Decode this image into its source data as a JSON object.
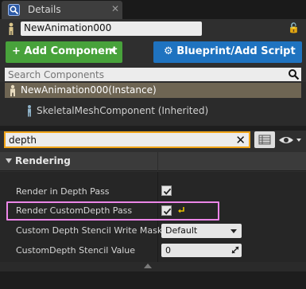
{
  "tab": {
    "title": "Details",
    "close_glyph": "✕",
    "icon": "details-magnifier-icon"
  },
  "actor": {
    "name": "NewAnimation000",
    "lock_glyph": "🔓"
  },
  "toolbar": {
    "add_component_label": "+ Add Component",
    "blueprint_label": "Blueprint/Add Script"
  },
  "component_search": {
    "placeholder": "Search Components"
  },
  "component_tree": {
    "root": {
      "label": "NewAnimation000(Instance)",
      "icon": "actor-instance-icon",
      "selected": true
    },
    "children": [
      {
        "label": "SkeletalMeshComponent (Inherited)",
        "icon": "skeletal-mesh-icon"
      }
    ]
  },
  "details_filter": {
    "value": "depth",
    "clear_glyph": "✕"
  },
  "category": {
    "label": "Rendering",
    "expanded": true
  },
  "properties": [
    {
      "label": "Render in Depth Pass",
      "type": "checkbox",
      "checked": true
    },
    {
      "label": "Render CustomDepth Pass",
      "type": "checkbox",
      "checked": true,
      "highlighted": true,
      "reset_to_default": true
    },
    {
      "label": "Custom Depth Stencil Write Mask",
      "type": "dropdown",
      "value": "Default"
    },
    {
      "label": "CustomDepth Stencil Value",
      "type": "number",
      "value": "0"
    }
  ],
  "colors": {
    "add_component": "#48a23b",
    "blueprint_button": "#1f73c0",
    "selected_row": "#6e6553",
    "filter_border": "#f0a418",
    "highlight_box": "#ec86e8"
  }
}
